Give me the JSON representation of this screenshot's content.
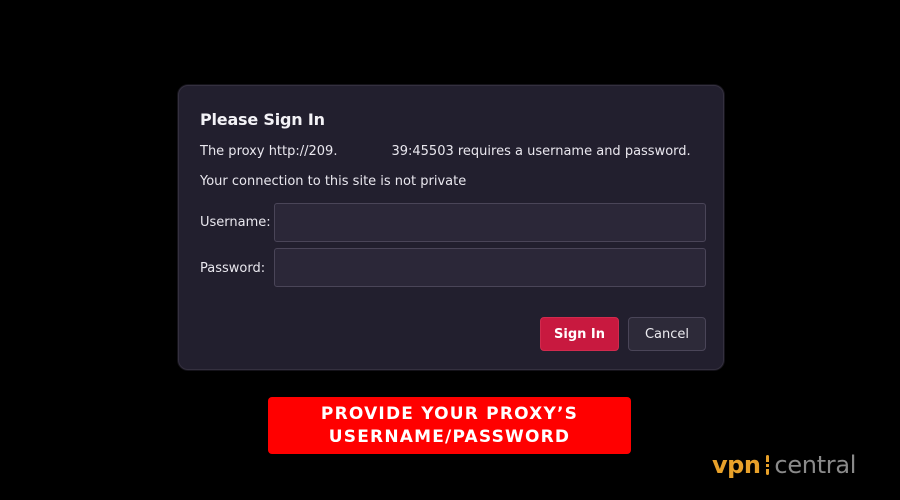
{
  "dialog": {
    "title": "Please Sign In",
    "proxy_prefix": "The proxy http://209.",
    "proxy_suffix": "39:45503 requires a username and password.",
    "privacy_notice": "Your connection to this site is not private",
    "username_label": "Username:",
    "username_value": "",
    "password_label": "Password:",
    "password_value": "",
    "sign_in_label": "Sign In",
    "cancel_label": "Cancel"
  },
  "banner": {
    "line1": "PROVIDE YOUR PROXY’S",
    "line2": "USERNAME/PASSWORD"
  },
  "logo": {
    "part1": "vpn",
    "part2": "central",
    "mark_icon": "signal-bar-icon"
  },
  "colors": {
    "background": "#000000",
    "dialog_bg": "#221f2e",
    "sign_in_button": "#c8193f",
    "banner_bg": "#ff0000",
    "logo_orange": "#e8a12a",
    "logo_gray": "#8a8a8a"
  }
}
